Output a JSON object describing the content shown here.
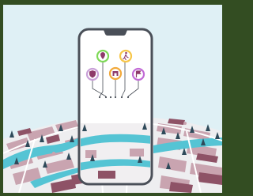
{
  "background": {
    "outer_frame_color": "#334d22",
    "sky_color": "#dff0f5",
    "map_base_color": "#eeeef0",
    "river_color": "#55c4d4",
    "block_color": "#b98a98",
    "block_dark_color": "#8e5266",
    "tree_color": "#2f4a5a"
  },
  "phone": {
    "frame_color": "#4a4f58",
    "screen_color": "#ffffff",
    "icons": [
      {
        "name": "location-pin-icon",
        "ring_color": "#7ed957"
      },
      {
        "name": "pedestrian-icon",
        "ring_color": "#f7c648"
      },
      {
        "name": "shield-icon",
        "ring_color": "#c9a0d8"
      },
      {
        "name": "storefront-icon",
        "ring_color": "#f2a93b"
      },
      {
        "name": "flag-icon",
        "ring_color": "#c26bd6"
      }
    ]
  }
}
